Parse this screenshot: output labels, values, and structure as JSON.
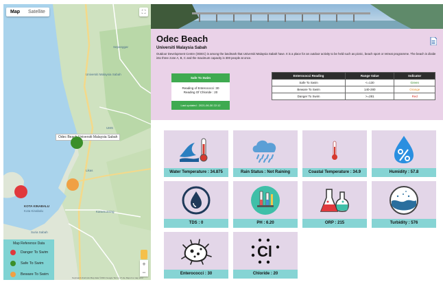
{
  "map": {
    "type_buttons": [
      "Map",
      "Satellite"
    ],
    "active_type": "Map",
    "tooltip": "Odec Beach Universiti Malaysia Sabah",
    "labels": [
      "Universiti Malaysia Sabah",
      "UMS",
      "KOTA KINABALU",
      "Kota Kinabalu",
      "Sepanggar",
      "Likas",
      "Karamunsing",
      "Suria Sabah"
    ],
    "zoom_in": "+",
    "zoom_out": "−",
    "attribution": "Keyboard shortcuts   Map data ©2021 Google   Terms of Use   Report a map error",
    "legend": {
      "title": "Map Reference Data",
      "items": [
        {
          "label": "Danger To Swim",
          "color": "#e0393d"
        },
        {
          "label": "Safe To Swim",
          "color": "#3b8f2a"
        },
        {
          "label": "Beware To Swim",
          "color": "#f0a044"
        }
      ]
    },
    "markers": [
      {
        "name": "odec-beach",
        "color": "#3b8f2a"
      },
      {
        "name": "danger-site",
        "color": "#e0393d"
      },
      {
        "name": "beware-site",
        "color": "#f0a044"
      }
    ]
  },
  "beach": {
    "title": "Odec Beach",
    "subtitle": "Universiti Malaysia Sabah",
    "description": "Outdoor Development Centre (ODEC) is among the landmark that Universiti Malaysia Sabah have. It is a place for an outdoor activity to be held such as picnic, beach sport or retreat programme. The beach is divide into three zone A, B, C and the maximum capacity is 300 people at once.",
    "doc_icon": "document-icon"
  },
  "status": {
    "label": "Safe To Swim",
    "enterococci": "Reading of Enterococci :30",
    "chloride": "Reading Of Chloride : 20",
    "updated": "Last updated : 2021-06-30 22:12",
    "color": "#3faa50"
  },
  "reference_table": {
    "headers": [
      "Enterococci Reading",
      "Range Value",
      "Indicator"
    ],
    "rows": [
      {
        "reading": "Safe To Swim",
        "range": "<=130",
        "indicator": "Green",
        "color": "#3a8a2a"
      },
      {
        "reading": "Beware To Swim",
        "range": "140-280",
        "indicator": "Orange",
        "color": "#e8922a"
      },
      {
        "reading": "Danger To Swim",
        "range": ">=281",
        "indicator": "Red",
        "color": "#d93025"
      }
    ]
  },
  "sensors": [
    {
      "label": "Water Temperature : 34.875",
      "icon": "water-temperature-icon"
    },
    {
      "label": "Rain Status : Not Raining",
      "icon": "rain-cloud-icon"
    },
    {
      "label": "Coastal Temperature : 34.9",
      "icon": "thermometer-icon"
    },
    {
      "label": "Humidity : 57.8",
      "icon": "humidity-drop-icon"
    },
    {
      "label": "TDS : 0",
      "icon": "tds-drop-icon"
    },
    {
      "label": "PH : 6.20",
      "icon": "ph-lab-icon"
    },
    {
      "label": "ORP : 215",
      "icon": "flask-icon"
    },
    {
      "label": "Turbidity : 576",
      "icon": "turbidity-icon"
    },
    {
      "label": "Enterococci : 30",
      "icon": "bacteria-icon"
    },
    {
      "label": "Chloride : 20",
      "icon": "chloride-icon"
    }
  ]
}
